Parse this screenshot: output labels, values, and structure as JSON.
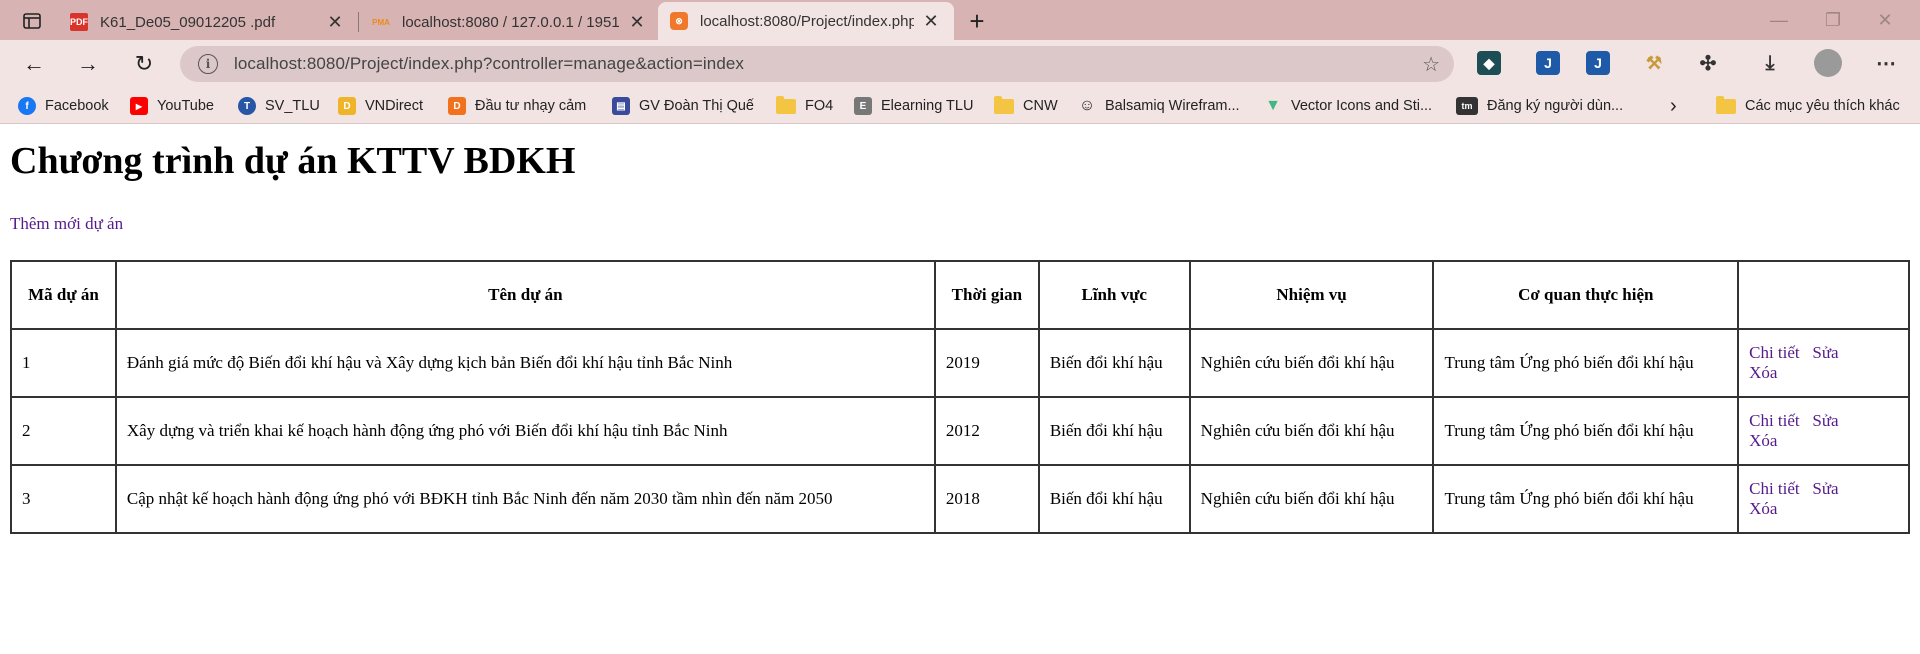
{
  "browser": {
    "tabs": [
      {
        "title": "K61_De05_09012205 .pdf",
        "icon": "pdf-icon",
        "active": false
      },
      {
        "title": "localhost:8080 / 127.0.0.1 / 1951",
        "icon": "phpmyadmin-icon",
        "active": false
      },
      {
        "title": "localhost:8080/Project/index.php",
        "icon": "xampp-icon",
        "active": true
      }
    ],
    "address": "localhost:8080/Project/index.php?controller=manage&action=index",
    "bookmarks": [
      {
        "label": "Facebook",
        "icon": "facebook-icon"
      },
      {
        "label": "YouTube",
        "icon": "youtube-icon"
      },
      {
        "label": "SV_TLU",
        "icon": "tlu-icon"
      },
      {
        "label": "VNDirect",
        "icon": "vndirect-icon"
      },
      {
        "label": "Đầu tư nhạy cảm",
        "icon": "dautu-icon"
      },
      {
        "label": "GV Đoàn Thị Quế",
        "icon": "bookmark-page-icon"
      },
      {
        "label": "FO4",
        "icon": "folder-icon"
      },
      {
        "label": "Elearning TLU",
        "icon": "elearning-icon"
      },
      {
        "label": "CNW",
        "icon": "folder-icon"
      },
      {
        "label": "Balsamiq Wirefram...",
        "icon": "balsamiq-icon"
      },
      {
        "label": "Vector Icons and Sti...",
        "icon": "vector-icon"
      },
      {
        "label": "Đăng ký người dùn...",
        "icon": "tm-icon"
      }
    ],
    "favorites_folder": "Các mục yêu thích khác"
  },
  "page": {
    "title": "Chương trình dự án KTTV BDKH",
    "add_link": "Thêm mới dự án",
    "table": {
      "headers": [
        "Mã dự án",
        "Tên dự án",
        "Thời gian",
        "Lĩnh vực",
        "Nhiệm vụ",
        "Cơ quan thực hiện",
        ""
      ],
      "rows": [
        {
          "id": "1",
          "name": "Đánh giá mức độ Biến đổi khí hậu và Xây dựng kịch bản Biến đổi khí hậu tỉnh Bắc Ninh",
          "year": "2019",
          "field": "Biến đổi khí hậu",
          "task": "Nghiên cứu biến đổi khí hậu",
          "agency": "Trung tâm Ứng phó biến đổi khí hậu"
        },
        {
          "id": "2",
          "name": "Xây dựng và triển khai kế hoạch hành động ứng phó với Biến đổi khí hậu tỉnh Bắc Ninh",
          "year": "2012",
          "field": "Biến đổi khí hậu",
          "task": "Nghiên cứu biến đổi khí hậu",
          "agency": "Trung tâm Ứng phó biến đổi khí hậu"
        },
        {
          "id": "3",
          "name": "Cập nhật kế hoạch hành động ứng phó với BĐKH tỉnh Bắc Ninh đến năm 2030 tầm nhìn đến năm 2050",
          "year": "2018",
          "field": "Biến đổi khí hậu",
          "task": "Nghiên cứu biến đổi khí hậu",
          "agency": "Trung tâm Ứng phó biến đổi khí hậu"
        }
      ],
      "actions": {
        "detail": "Chi tiết",
        "edit": "Sửa",
        "delete": "Xóa"
      }
    }
  }
}
